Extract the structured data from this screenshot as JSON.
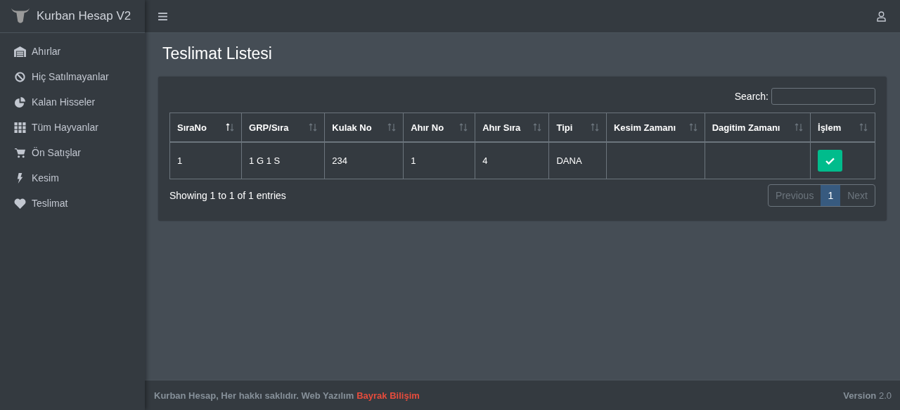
{
  "brand": {
    "title": "Kurban Hesap V2"
  },
  "sidebar": {
    "items": [
      {
        "label": "Ahırlar"
      },
      {
        "label": "Hiç Satılmayanlar"
      },
      {
        "label": "Kalan Hisseler"
      },
      {
        "label": "Tüm Hayvanlar"
      },
      {
        "label": "Ön Satışlar"
      },
      {
        "label": "Kesim"
      },
      {
        "label": "Teslimat"
      }
    ]
  },
  "page": {
    "title": "Teslimat Listesi"
  },
  "search": {
    "label": "Search:"
  },
  "table": {
    "columns": [
      {
        "label": "SıraNo",
        "sorted": true
      },
      {
        "label": "GRP/Sıra",
        "sorted": false
      },
      {
        "label": "Kulak No",
        "sorted": false
      },
      {
        "label": "Ahır No",
        "sorted": false
      },
      {
        "label": "Ahır Sıra",
        "sorted": false
      },
      {
        "label": "Tipi",
        "sorted": false
      },
      {
        "label": "Kesim Zamanı",
        "sorted": false
      },
      {
        "label": "Dagitim Zamanı",
        "sorted": false
      },
      {
        "label": "İşlem",
        "sorted": false
      }
    ],
    "rows": [
      {
        "cells": [
          "1",
          "1 G 1 S",
          "234",
          "1",
          "4",
          "DANA",
          null,
          null
        ],
        "action": {
          "kind": "check"
        }
      }
    ]
  },
  "info": "Showing 1 to 1 of 1 entries",
  "pagination": [
    {
      "label": "Previous",
      "disabled": true,
      "selected": false
    },
    {
      "label": "1",
      "disabled": false,
      "selected": true
    },
    {
      "label": "Next",
      "disabled": true,
      "selected": false
    }
  ],
  "footer": {
    "text": "Kurban Hesap, Her hakkı saklıdır. Web Yazılım",
    "link": "Bayrak Bilişim",
    "version": "**Version** 2.0"
  }
}
